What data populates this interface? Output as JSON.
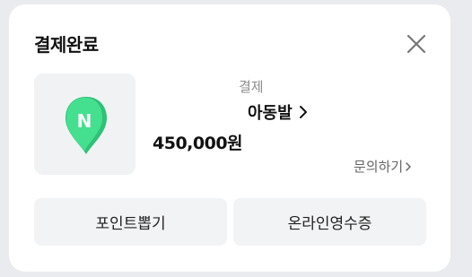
{
  "modal": {
    "title": "결제완료",
    "close_icon": "close-icon"
  },
  "payment": {
    "thumbnail_icon": "naver-pay-pin-icon",
    "logo_letter": "N",
    "label": "결제",
    "merchant": "아동발",
    "amount": "450,000원",
    "inquiry_link": "문의하기"
  },
  "actions": {
    "points_button": "포인트뽑기",
    "receipt_button": "온라인영수증"
  },
  "colors": {
    "brand_green": "#3ddc84",
    "card_bg": "#ffffff",
    "button_bg": "#f2f3f5"
  }
}
